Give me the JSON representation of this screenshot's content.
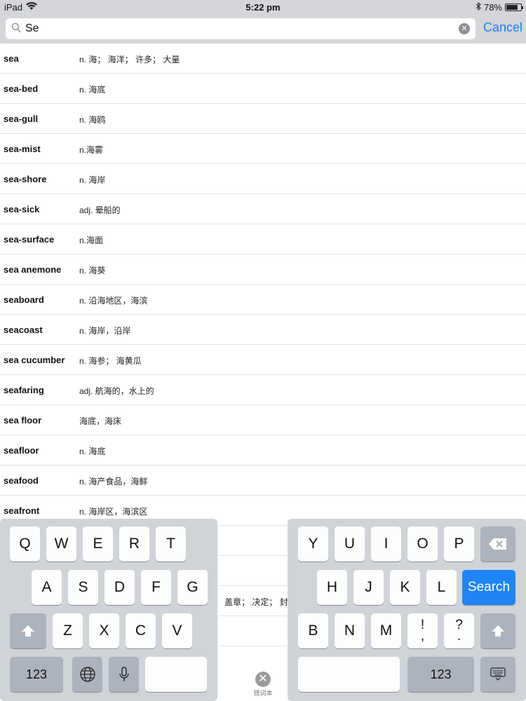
{
  "status": {
    "device": "iPad",
    "time": "5:22 pm",
    "battery": "78%",
    "battery_level": 0.78
  },
  "search": {
    "value": "Se",
    "cancel": "Cancel"
  },
  "entries": [
    {
      "word": "sea",
      "def": "n. 海； 海洋； 许多； 大量"
    },
    {
      "word": "sea-bed",
      "def": "n. 海底"
    },
    {
      "word": "sea-gull",
      "def": "n. 海鸥"
    },
    {
      "word": "sea-mist",
      "def": "n.海雾"
    },
    {
      "word": "sea-shore",
      "def": "n. 海岸"
    },
    {
      "word": "sea-sick",
      "def": "adj. 晕船的"
    },
    {
      "word": "sea-surface",
      "def": "n.海面"
    },
    {
      "word": "sea anemone",
      "def": "n. 海葵"
    },
    {
      "word": "seaboard",
      "def": "n. 沿海地区，海滨"
    },
    {
      "word": "seacoast",
      "def": "n. 海岸，沿岸"
    },
    {
      "word": "sea cucumber",
      "def": "n. 海参； 海黄瓜"
    },
    {
      "word": "seafaring",
      "def": "adj. 航海的，水上的"
    },
    {
      "word": "sea floor",
      "def": "海底，海床"
    },
    {
      "word": "seafloor",
      "def": "n. 海底"
    },
    {
      "word": "seafood",
      "def": "n. 海产食品，海鲜"
    },
    {
      "word": "seafront",
      "def": "n. 海岸区，海滨区"
    }
  ],
  "peek_text": "盖章； 决定； 封",
  "tab": {
    "label": "错词本"
  },
  "keyboard": {
    "left": {
      "row1": [
        "Q",
        "W",
        "E",
        "R",
        "T"
      ],
      "row2": [
        "A",
        "S",
        "D",
        "F",
        "G"
      ],
      "row3": [
        "Z",
        "X",
        "C",
        "V"
      ],
      "numbers": "123"
    },
    "right": {
      "row1": [
        "Y",
        "U",
        "I",
        "O",
        "P"
      ],
      "row2": [
        "H",
        "J",
        "K",
        "L"
      ],
      "search": "Search",
      "row3": [
        "B",
        "N",
        "M",
        "!\n,",
        "?\n."
      ],
      "numbers": "123"
    }
  },
  "colors": {
    "accent": "#1e7cf6",
    "keyboard_bg": "#d0d3d8",
    "search_key": "#1f84f5"
  }
}
